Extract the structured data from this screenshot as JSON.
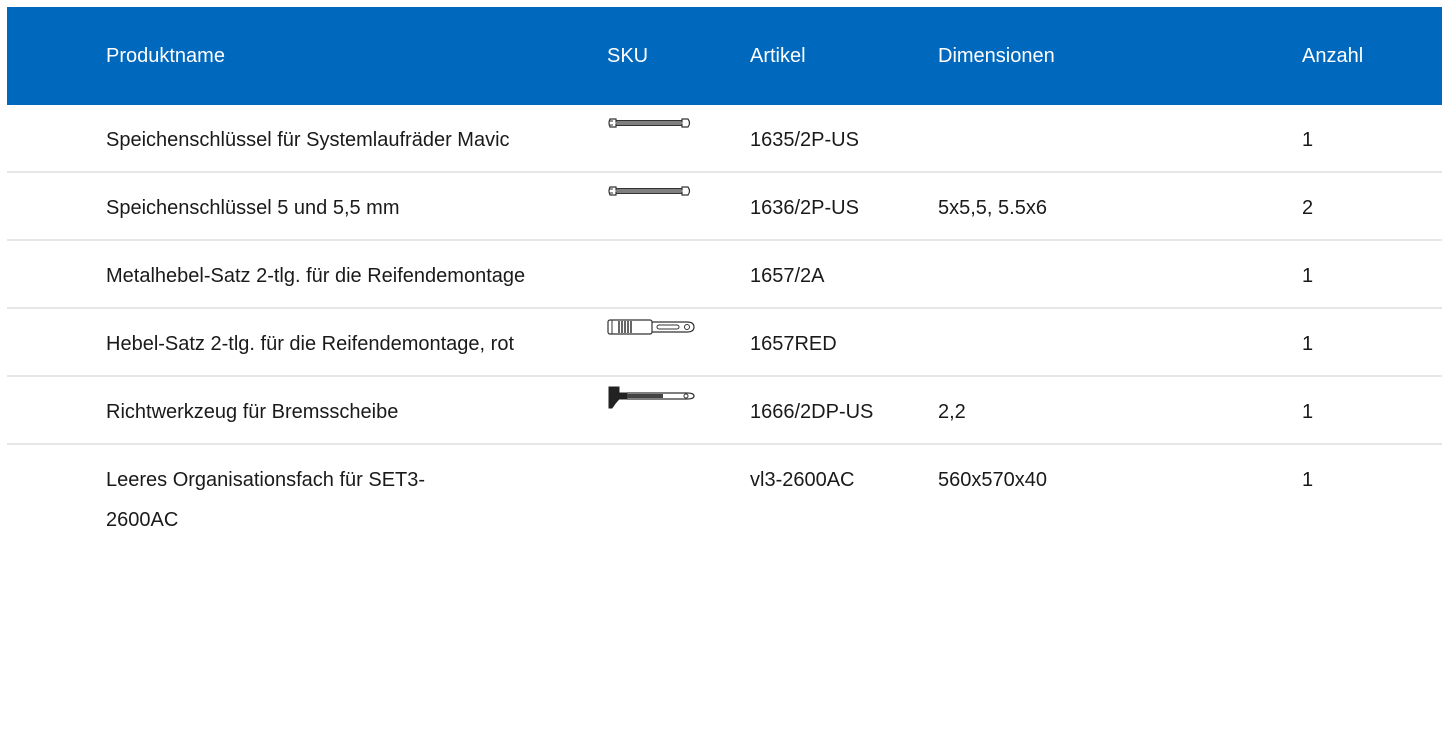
{
  "table": {
    "headers": {
      "name": "Produktname",
      "sku": "SKU",
      "article": "Artikel",
      "dimensions": "Dimensionen",
      "quantity": "Anzahl"
    },
    "rows": [
      {
        "name": "Speichenschlüssel für Systemlaufräder Mavic",
        "sku_icon": "spoke-wrench-icon",
        "article": "1635/2P-US",
        "dimensions": "",
        "quantity": "1"
      },
      {
        "name": "Speichenschlüssel 5 und 5,5 mm",
        "sku_icon": "spoke-wrench-icon",
        "article": "1636/2P-US",
        "dimensions": "5x5,5, 5.5x6",
        "quantity": "2"
      },
      {
        "name": "Metalhebel-Satz 2-tlg. für die Reifendemontage",
        "sku_icon": "",
        "article": "1657/2A",
        "dimensions": "",
        "quantity": "1"
      },
      {
        "name": "Hebel-Satz 2-tlg. für die Reifendemontage, rot",
        "sku_icon": "tire-lever-icon",
        "article": "1657RED",
        "dimensions": "",
        "quantity": "1"
      },
      {
        "name": "Richtwerkzeug für Bremsscheibe",
        "sku_icon": "rotor-truing-tool-icon",
        "article": "1666/2DP-US",
        "dimensions": "2,2",
        "quantity": "1"
      },
      {
        "name": "Leeres Organisationsfach für SET3-2600AC",
        "sku_icon": "",
        "article": "vl3-2600AC",
        "dimensions": "560x570x40",
        "quantity": "1"
      }
    ]
  },
  "colors": {
    "header_bg": "#0068bd",
    "header_text": "#ffffff",
    "row_divider": "#e6e6e6"
  }
}
